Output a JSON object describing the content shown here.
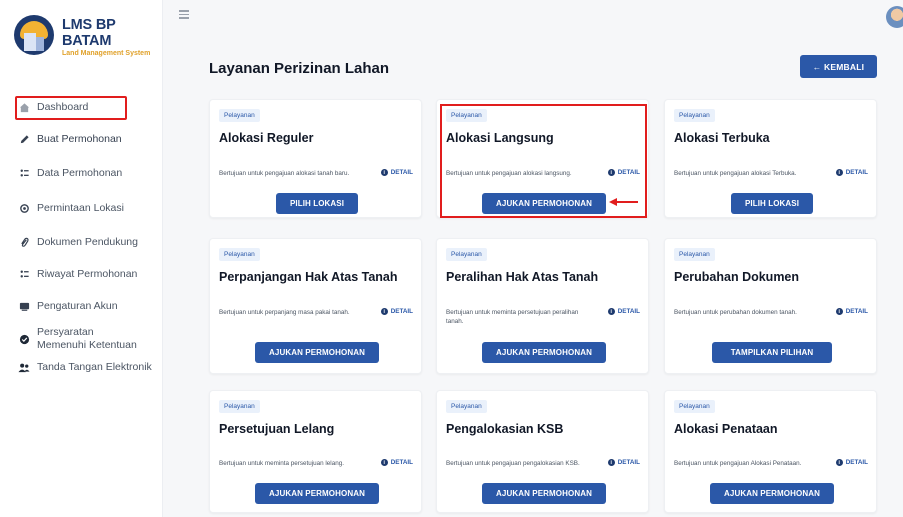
{
  "app": {
    "logo_title": "LMS BP BATAM",
    "logo_subtitle": "Land Management System"
  },
  "sidebar": {
    "items": [
      {
        "label": "Dashboard",
        "icon": "home-icon"
      },
      {
        "label": "Buat Permohonan",
        "icon": "pencil-icon"
      },
      {
        "label": "Data Permohonan",
        "icon": "list-icon"
      },
      {
        "label": "Permintaan Lokasi",
        "icon": "location-icon"
      },
      {
        "label": "Dokumen Pendukung",
        "icon": "paperclip-icon"
      },
      {
        "label": "Riwayat Permohonan",
        "icon": "history-icon"
      },
      {
        "label": "Pengaturan Akun",
        "icon": "account-settings-icon"
      },
      {
        "label": "Persyaratan Memenuhi Ketentuan",
        "icon": "check-circle-icon"
      },
      {
        "label": "Tanda Tangan Elektronik",
        "icon": "users-icon"
      }
    ]
  },
  "main": {
    "title": "Layanan Perizinan Lahan",
    "back_label": "← KEMBALI",
    "badge_label": "Pelayanan",
    "detail_label": "DETAIL",
    "cards": [
      {
        "title": "Alokasi Reguler",
        "desc": "Bertujuan untuk pengajuan alokasi tanah baru.",
        "button": "PILIH LOKASI"
      },
      {
        "title": "Alokasi Langsung",
        "desc": "Bertujuan untuk pengajuan alokasi langsung.",
        "button": "AJUKAN PERMOHONAN"
      },
      {
        "title": "Alokasi Terbuka",
        "desc": "Bertujuan untuk pengajuan alokasi Terbuka.",
        "button": "PILIH LOKASI"
      },
      {
        "title": "Perpanjangan Hak Atas Tanah",
        "desc": "Bertujuan untuk perpanjang masa pakai tanah.",
        "button": "AJUKAN PERMOHONAN"
      },
      {
        "title": "Peralihan Hak Atas Tanah",
        "desc": "Bertujuan untuk meminta persetujuan peralihan tanah.",
        "button": "AJUKAN PERMOHONAN"
      },
      {
        "title": "Perubahan Dokumen",
        "desc": "Bertujuan untuk perubahan dokumen tanah.",
        "button": "TAMPILKAN PILIHAN"
      },
      {
        "title": "Persetujuan Lelang",
        "desc": "Bertujuan untuk meminta persetujuan lelang.",
        "button": "AJUKAN PERMOHONAN"
      },
      {
        "title": "Pengalokasian KSB",
        "desc": "Bertujuan untuk pengajuan pengalokasian KSB.",
        "button": "AJUKAN PERMOHONAN"
      },
      {
        "title": "Alokasi Penataan",
        "desc": "Bertujuan untuk pengajuan Alokasi Penataan.",
        "button": "AJUKAN PERMOHONAN"
      }
    ]
  },
  "colors": {
    "primary": "#2b58a8",
    "brand_navy": "#1e3a6e",
    "annotation_red": "#e11d1d"
  }
}
